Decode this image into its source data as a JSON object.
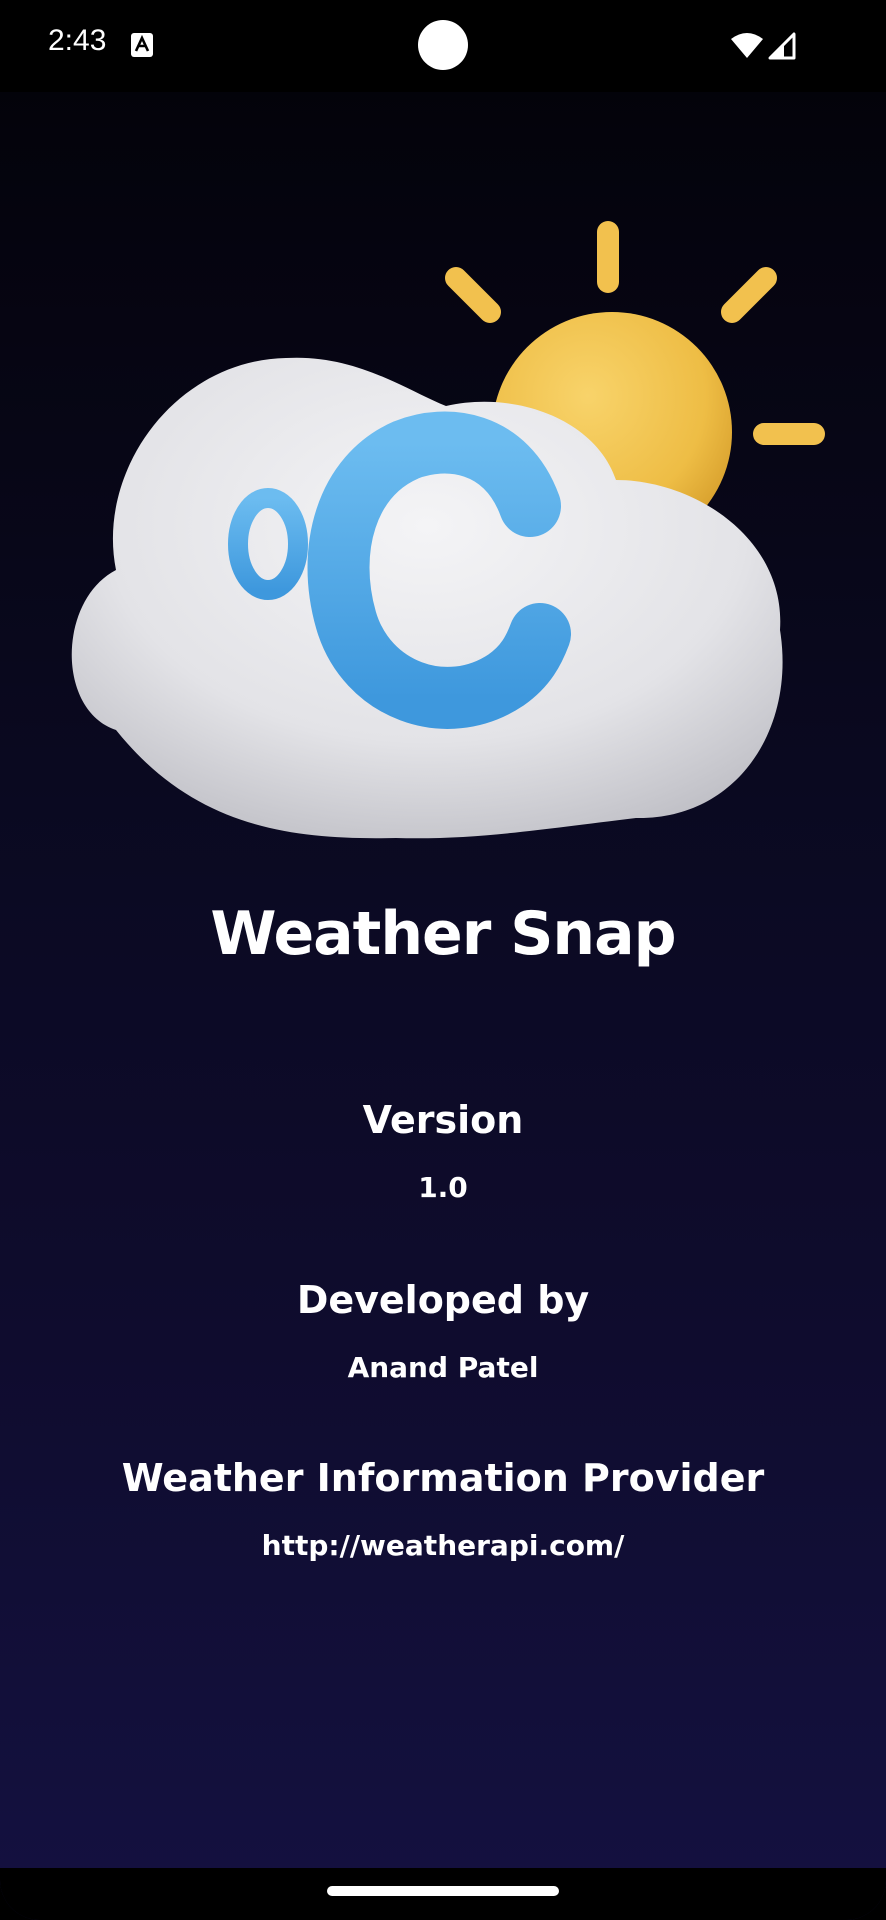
{
  "status_bar": {
    "time": "2:43",
    "notification_icon": "accessibility-a-icon",
    "wifi_icon": "wifi-icon",
    "signal_icon": "cell-signal-icon"
  },
  "hero": {
    "icon": "weather-cloud-sun-celsius-icon",
    "symbol": "°C"
  },
  "app": {
    "title": "Weather Snap"
  },
  "sections": {
    "version": {
      "heading": "Version",
      "value": "1.0"
    },
    "developer": {
      "heading": "Developed by",
      "value": "Anand Patel"
    },
    "provider": {
      "heading": "Weather Information Provider",
      "value": "http://weatherapi.com/"
    }
  },
  "colors": {
    "background_top": "#020207",
    "background_bottom": "#141141",
    "text": "#ffffff",
    "sun": "#f2c14e",
    "celsius_blue": "#4fa8e6",
    "cloud": "#e9e9ec"
  }
}
